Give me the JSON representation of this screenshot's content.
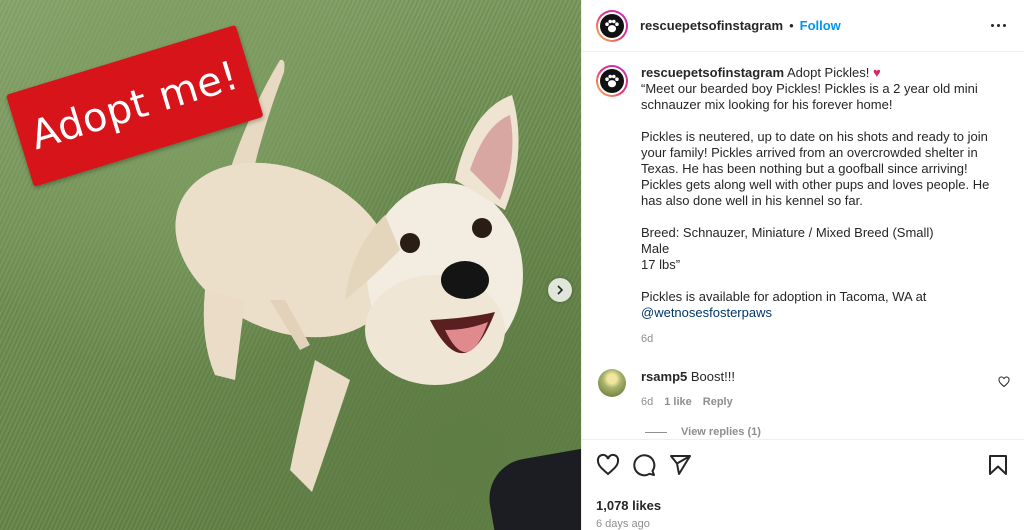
{
  "post": {
    "sign_text": "Adopt me!"
  },
  "header": {
    "username": "rescuepetsofinstagram",
    "separator": "•",
    "follow_label": "Follow"
  },
  "caption": {
    "username": "rescuepetsofinstagram",
    "title": "Adopt Pickles!",
    "emoji": "♥",
    "paragraph1": "“Meet our bearded boy Pickles! Pickles is a 2 year old mini schnauzer mix looking for his forever home!",
    "paragraph2": "Pickles is neutered, up to date on his shots and ready to join your family! Pickles arrived from an overcrowded shelter in Texas. He has been nothing but a goofball since arriving! Pickles gets along well with other pups and loves people. He has also done well in his kennel so far.",
    "breed": "Breed: Schnauzer, Miniature / Mixed Breed (Small)",
    "sex": "Male",
    "weight": "17 lbs”",
    "availability": "Pickles is available for adoption in Tacoma, WA at",
    "mention": "@wetnosesfosterpaws",
    "time": "6d"
  },
  "comment": {
    "username": "rsamp5",
    "text": "Boost!!!",
    "time": "6d",
    "likes": "1 like",
    "reply_label": "Reply",
    "view_replies": "View replies (1)"
  },
  "footer": {
    "likes": "1,078 likes",
    "date": "6 days ago"
  },
  "icons": [
    "paw-icon",
    "more-options-icon",
    "heart-icon",
    "comment-icon",
    "share-icon",
    "bookmark-icon",
    "chevron-right-icon"
  ]
}
